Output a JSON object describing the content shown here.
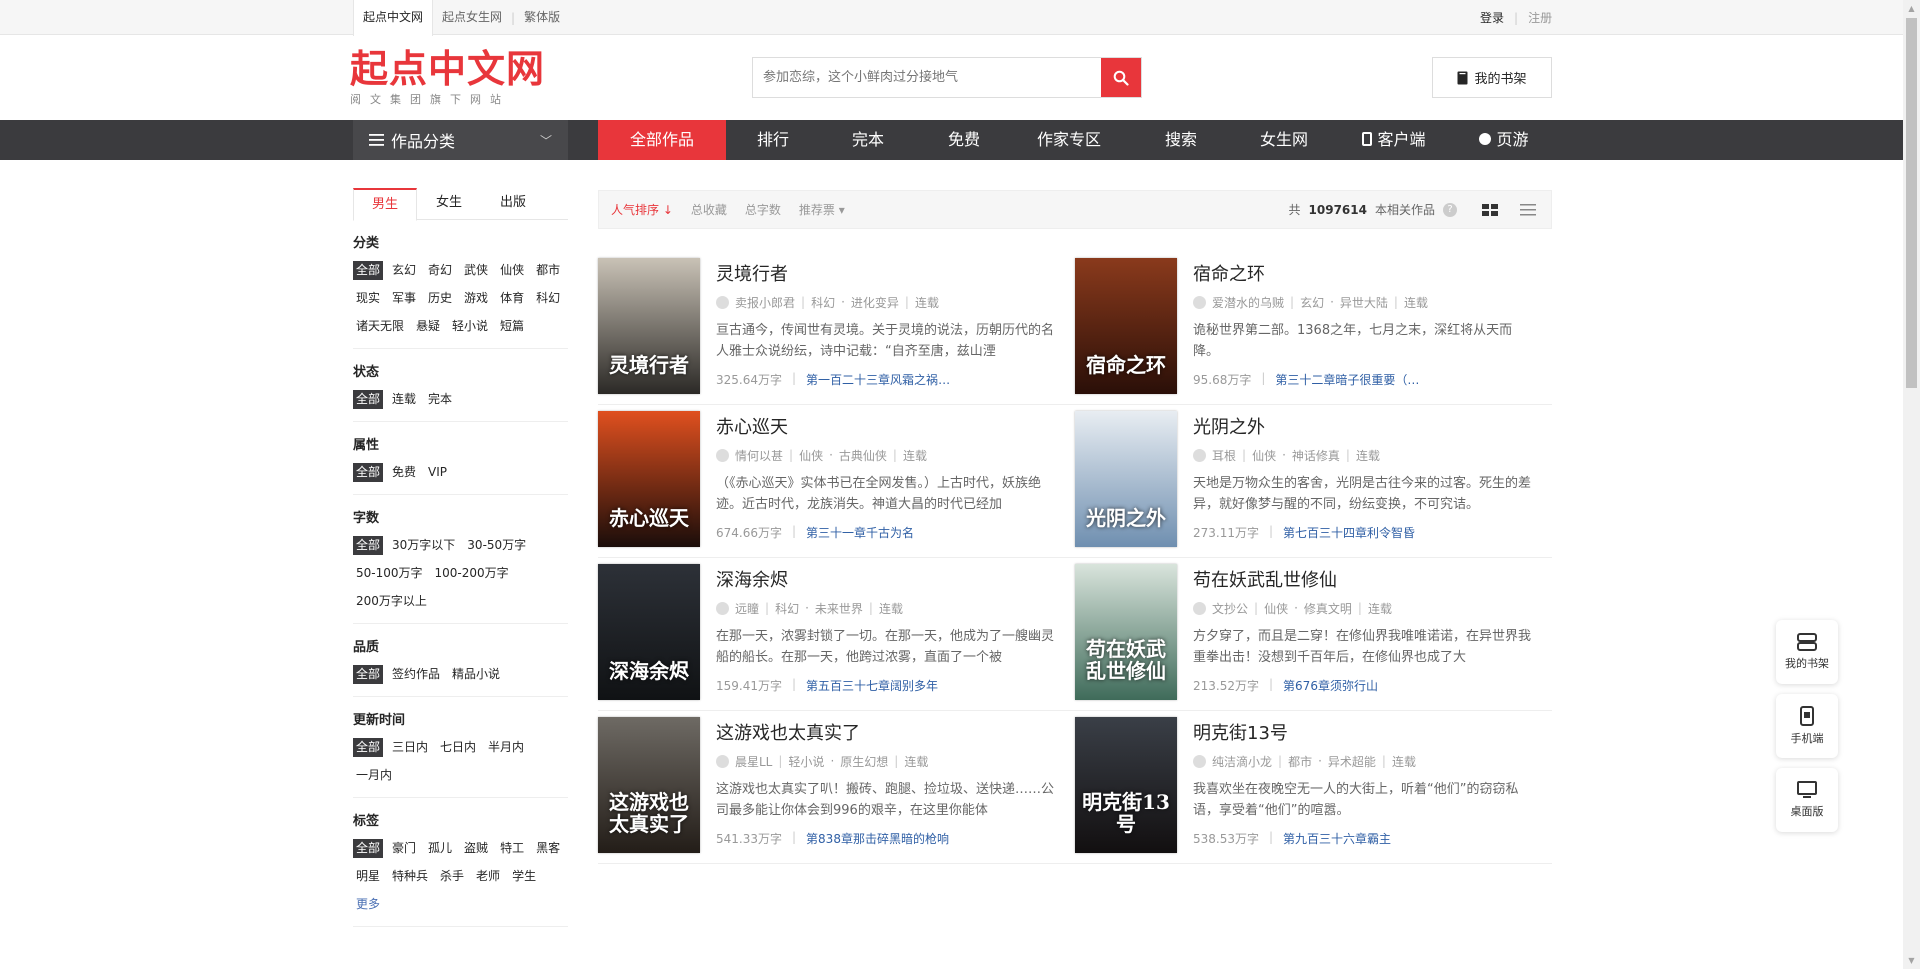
{
  "top_bar": {
    "tabs": [
      "起点中文网",
      "起点女生网",
      "繁体版"
    ],
    "login": "登录",
    "sep": "|",
    "register": "注册"
  },
  "header": {
    "logo": "起点中文网",
    "logo_sub": "阅文集团旗下网站",
    "search_placeholder": "参加恋综，这个小鲜肉过分接地气",
    "bookshelf": "我的书架"
  },
  "nav": {
    "category": "作品分类",
    "items": [
      "全部作品",
      "排行",
      "完本",
      "免费",
      "作家专区",
      "搜索",
      "女生网",
      "客户端",
      "页游"
    ]
  },
  "sidebar": {
    "tabs": [
      "男生",
      "女生",
      "出版"
    ],
    "groups": [
      {
        "title": "分类",
        "items": [
          "全部",
          "玄幻",
          "奇幻",
          "武侠",
          "仙侠",
          "都市",
          "现实",
          "军事",
          "历史",
          "游戏",
          "体育",
          "科幻",
          "诸天无限",
          "悬疑",
          "轻小说",
          "短篇"
        ]
      },
      {
        "title": "状态",
        "items": [
          "全部",
          "连载",
          "完本"
        ]
      },
      {
        "title": "属性",
        "items": [
          "全部",
          "免费",
          "VIP"
        ]
      },
      {
        "title": "字数",
        "items": [
          "全部",
          "30万字以下",
          "30-50万字",
          "50-100万字",
          "100-200万字",
          "200万字以上"
        ]
      },
      {
        "title": "品质",
        "items": [
          "全部",
          "签约作品",
          "精品小说"
        ]
      },
      {
        "title": "更新时间",
        "items": [
          "全部",
          "三日内",
          "七日内",
          "半月内",
          "一月内"
        ]
      },
      {
        "title": "标签",
        "items": [
          "全部",
          "豪门",
          "孤儿",
          "盗贼",
          "特工",
          "黑客",
          "明星",
          "特种兵",
          "杀手",
          "老师",
          "学生",
          "更多"
        ]
      }
    ]
  },
  "sort_bar": {
    "items": [
      "人气排序 ↓",
      "总收藏",
      "总字数",
      "推荐票 ▾"
    ],
    "total_prefix": "共",
    "total_count": "1097614",
    "total_suffix": "本相关作品",
    "help": "?"
  },
  "books": [
    {
      "title": "灵境行者",
      "author": "卖报小郎君",
      "cat": "科幻",
      "sub": "进化变异",
      "status": "连载",
      "intro": "亘古通今，传闻世有灵境。关于灵境的说法，历朝历代的名人雅士众说纷纭，诗中记载：“自齐至唐，兹山湮",
      "words": "325.64万字",
      "chapter": "第一百二十三章风霜之祸……",
      "cover_text": "灵境行者",
      "color_top": "#c9c2b6",
      "color_bottom": "#2b2926"
    },
    {
      "title": "宿命之环",
      "author": "爱潜水的乌贼",
      "cat": "玄幻",
      "sub": "异世大陆",
      "status": "连载",
      "intro": "诡秘世界第二部。1368之年，七月之末，深红将从天而降。",
      "words": "95.68万字",
      "chapter": "第三十二章暗子很重要（…",
      "cover_text": "宿命之环",
      "color_top": "#8a3a1c",
      "color_bottom": "#2a0f08"
    },
    {
      "title": "赤心巡天",
      "author": "情何以甚",
      "cat": "仙侠",
      "sub": "古典仙侠",
      "status": "连载",
      "intro": "（《赤心巡天》实体书已在全网发售。）上古时代，妖族绝迹。近古时代，龙族消失。神道大昌的时代已经加",
      "words": "674.66万字",
      "chapter": "第三十一章千古为名",
      "cover_text": "赤心巡天",
      "color_top": "#e0501f",
      "color_bottom": "#1a0d0a"
    },
    {
      "title": "光阴之外",
      "author": "耳根",
      "cat": "仙侠",
      "sub": "神话修真",
      "status": "连载",
      "intro": "天地是万物众生的客舍，光阴是古往今来的过客。死生的差异，就好像梦与醒的不同，纷纭变换，不可究诘。",
      "words": "273.11万字",
      "chapter": "第七百三十四章利令智昏",
      "cover_text": "光阴之外",
      "color_top": "#e8edf2",
      "color_bottom": "#6f8fb0"
    },
    {
      "title": "深海余烬",
      "author": "远瞳",
      "cat": "科幻",
      "sub": "未来世界",
      "status": "连载",
      "intro": "在那一天，浓雾封锁了一切。在那一天，他成为了一艘幽灵船的船长。在那一天，他跨过浓雾，直面了一个被",
      "words": "159.41万字",
      "chapter": "第五百三十七章阔别多年",
      "cover_text": "深海余烬",
      "color_top": "#2d3138",
      "color_bottom": "#101214"
    },
    {
      "title": "苟在妖武乱世修仙",
      "author": "文抄公",
      "cat": "仙侠",
      "sub": "修真文明",
      "status": "连载",
      "intro": "方夕穿了，而且是二穿！在修仙界我唯唯诺诺，在异世界我重拳出击！没想到千百年后，在修仙界也成了大",
      "words": "213.52万字",
      "chapter": "第676章须弥行山",
      "cover_text": "苟在妖武乱世修仙",
      "color_top": "#d9e4dc",
      "color_bottom": "#3f6b5a"
    },
    {
      "title": "这游戏也太真实了",
      "author": "晨星LL",
      "cat": "轻小说",
      "sub": "原生幻想",
      "status": "连载",
      "intro": "这游戏也太真实了叭！搬砖、跑腿、捡垃圾、送快递……公司最多能让你体会到996的艰辛，在这里你能体",
      "words": "541.33万字",
      "chapter": "第838章那击碎黑暗的枪响",
      "cover_text": "这游戏也太真实了",
      "color_top": "#6e6a64",
      "color_bottom": "#231d18"
    },
    {
      "title": "明克街13号",
      "author": "纯洁滴小龙",
      "cat": "都市",
      "sub": "异术超能",
      "status": "连载",
      "intro": "我喜欢坐在夜晚空无一人的大街上，听着“他们”的窃窃私语，享受着“他们”的喧嚣。",
      "words": "538.53万字",
      "chapter": "第九百三十六章霸主",
      "cover_text": "明克街13号",
      "color_top": "#3a3f47",
      "color_bottom": "#120f10"
    }
  ],
  "float_panel": [
    "我的书架",
    "手机端",
    "桌面版"
  ]
}
